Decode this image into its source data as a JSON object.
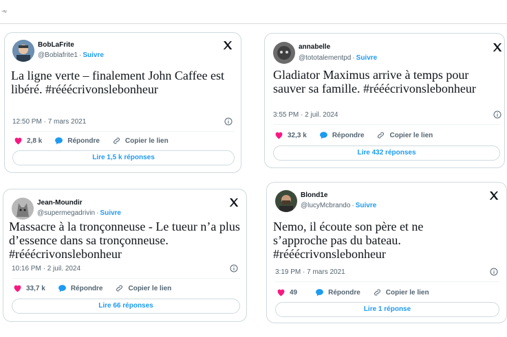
{
  "header": {
    "mark": "⁃ny"
  },
  "tweets": [
    {
      "name": "BobLaFrite",
      "handle": "@Boblafrite1",
      "follow": "Suivre",
      "text": "La ligne verte – finalement John Caffee est libéré. #rééécrivonslebonheur",
      "timestamp": "12:50 PM · 7 mars 2021",
      "likes": "2,8 k",
      "reply_label": "Répondre",
      "copy_label": "Copier le lien",
      "replies_button": "Lire 1,5 k réponses"
    },
    {
      "name": "annabelle",
      "handle": "@tototalementpd",
      "follow": "Suivre",
      "text": "Gladiator Maximus arrive à temps pour sauver sa famille. #rééécrivonslebonheur",
      "timestamp": "3:55 PM · 2 juil. 2024",
      "likes": "32,3 k",
      "reply_label": "Répondre",
      "copy_label": "Copier le lien",
      "replies_button": "Lire 432 réponses"
    },
    {
      "name": "Jean-Moundir",
      "handle": "@supermegadrivin",
      "follow": "Suivre",
      "text": "Massacre à la tronçonneuse -  Le tueur n’a plus d’essence dans sa tronçonneuse. #rééécrivonslebonheur",
      "timestamp": "10:16 PM · 2 juil. 2024",
      "likes": "33,7 k",
      "reply_label": "Répondre",
      "copy_label": "Copier le lien",
      "replies_button": "Lire 66 réponses"
    },
    {
      "name": "Blond1e",
      "handle": "@lucyMcbrando",
      "follow": "Suivre",
      "text": "Nemo, il écoute son père et ne s’approche pas du bateau. #rééécrivonslebonheur",
      "timestamp": "3:19 PM · 7 mars 2021",
      "likes": "49",
      "reply_label": "Répondre",
      "copy_label": "Copier le lien",
      "replies_button": "Lire 1 réponse"
    }
  ],
  "colors": {
    "accent": "#1d9bf0",
    "like": "#f91880",
    "text": "#0f1419",
    "muted": "#536471",
    "border": "#cfd9de"
  },
  "icons": [
    "x-logo-icon",
    "info-icon",
    "heart-icon",
    "reply-bubble-icon",
    "link-icon"
  ]
}
